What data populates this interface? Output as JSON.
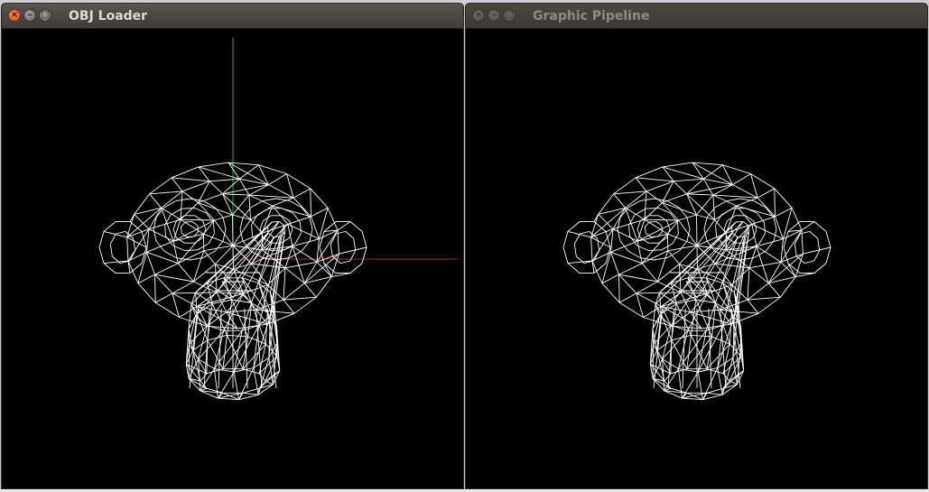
{
  "windows": {
    "left": {
      "title": "OBJ Loader",
      "controls": {
        "close": "close-icon",
        "minimize": "minimize-icon",
        "maximize": "maximize-icon"
      },
      "axis_colors": {
        "x": "#d01818",
        "y": "#10c010"
      },
      "mesh_color": "#ffffff",
      "background": "#000000"
    },
    "right": {
      "title": "Graphic Pipeline",
      "controls": {
        "close": "close-icon",
        "minimize": "minimize-icon",
        "maximize": "maximize-icon"
      },
      "mesh_color": "#ffffff",
      "background": "#000000"
    }
  }
}
